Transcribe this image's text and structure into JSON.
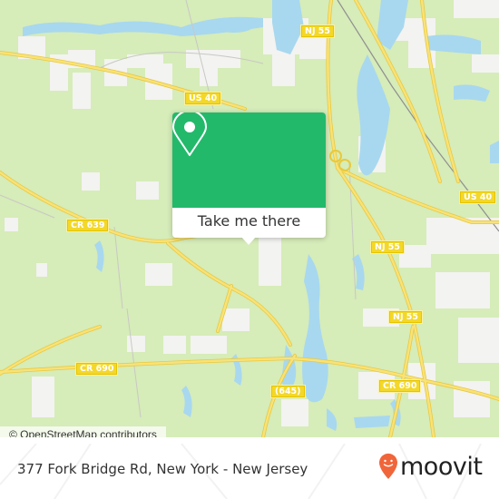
{
  "map": {
    "road_labels": [
      {
        "id": "nj55-top",
        "text": "NJ 55"
      },
      {
        "id": "us40-top",
        "text": "US 40"
      },
      {
        "id": "us40-right",
        "text": "US 40"
      },
      {
        "id": "cr639",
        "text": "CR 639"
      },
      {
        "id": "nj55-mid",
        "text": "NJ 55"
      },
      {
        "id": "nj55-low",
        "text": "NJ 55"
      },
      {
        "id": "cr690-left",
        "text": "CR 690"
      },
      {
        "id": "cr690-right",
        "text": "CR 690"
      },
      {
        "id": "r645",
        "text": "(645)"
      }
    ],
    "attribution": "© OpenStreetMap contributors"
  },
  "popup": {
    "icon": "location-pin-icon",
    "button_label": "Take me there"
  },
  "footer": {
    "address": "377 Fork Bridge Rd, New York - New Jersey",
    "brand": "moovit",
    "brand_color": "#f0653a"
  },
  "colors": {
    "land": "#d6ecb9",
    "water": "#a8d8ef",
    "urban": "#f3f3f1",
    "road": "#f6dc4e",
    "popup_green": "#22b96b"
  }
}
